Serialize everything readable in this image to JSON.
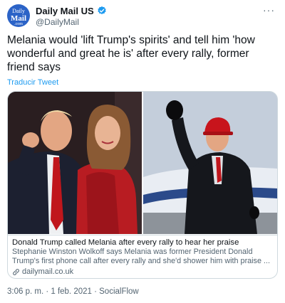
{
  "account": {
    "avatar_line1": "Daily",
    "avatar_line2": "Mail",
    "avatar_line3": ".com",
    "display_name": "Daily Mail US",
    "handle": "@DailyMail",
    "brand_color": "#2b63c7",
    "verified_color": "#1d9bf0"
  },
  "tweet": {
    "text": "Melania would 'lift Trump's spirits' and tell him 'how wonderful and great he is' after every rally, former friend says",
    "translate_label": "Traducir Tweet",
    "more_icon": "more-horizontal-icon"
  },
  "card": {
    "title": "Donald Trump called Melania after every rally to hear her praise",
    "description": "Stephanie Winston Wolkoff says Melania was former President Donald Trump's first phone call after every rally and she'd shower him with praise ...",
    "domain": "dailymail.co.uk",
    "domain_icon": "link-icon"
  },
  "meta": {
    "timestamp": "3:06 p. m. · 1 feb. 2021 · SocialFlow"
  }
}
